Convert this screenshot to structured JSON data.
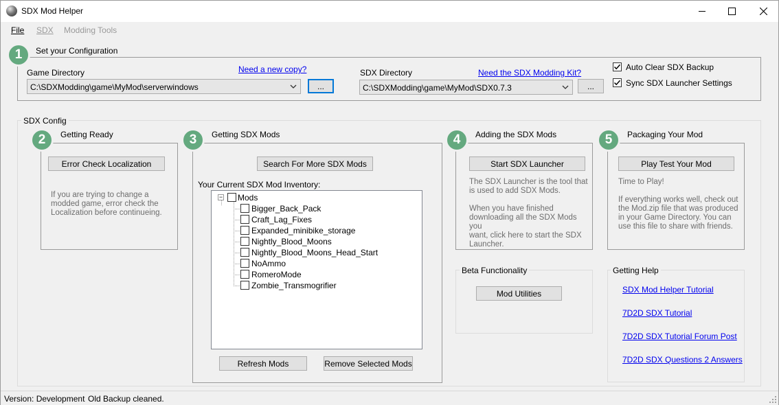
{
  "window": {
    "title": "SDX Mod Helper",
    "accent": "#64a97f",
    "link_color": "#0000ee"
  },
  "menu": {
    "file": "File",
    "sdx": "SDX",
    "modding_tools": "Modding Tools"
  },
  "config": {
    "step": "1",
    "title": "Set your Configuration",
    "game_dir_label": "Game Directory",
    "game_dir_link": "Need a new copy?",
    "game_dir_value": "C:\\SDXModding\\game\\MyMod\\serverwindows",
    "browse_label": "...",
    "sdx_dir_label": "SDX Directory",
    "sdx_dir_link": "Need the SDX Modding Kit?",
    "sdx_dir_value": "C:\\SDXModding\\game\\MyMod\\SDX0.7.3",
    "auto_clear_label": "Auto Clear SDX Backup",
    "auto_clear_checked": true,
    "sync_label": "Sync SDX Launcher Settings",
    "sync_checked": true
  },
  "sdx_config": {
    "title": "SDX Config"
  },
  "getting_ready": {
    "step": "2",
    "title": "Getting Ready",
    "button": "Error Check Localization",
    "desc_lines": [
      "If you are trying to change a",
      "modded game, error check the",
      "Localization before continueing."
    ]
  },
  "getting_mods": {
    "step": "3",
    "title": "Getting SDX Mods",
    "search_button": "Search For More SDX Mods",
    "inventory_label": "Your Current SDX Mod Inventory:",
    "tree_root": "Mods",
    "tree_expander": "−",
    "mods": [
      "Bigger_Back_Pack",
      "Craft_Lag_Fixes",
      "Expanded_minibike_storage",
      "Nightly_Blood_Moons",
      "Nightly_Blood_Moons_Head_Start",
      "NoAmmo",
      "RomeroMode",
      "Zombie_Transmogrifier"
    ],
    "refresh_button": "Refresh Mods",
    "remove_button": "Remove Selected Mods"
  },
  "adding_mods": {
    "step": "4",
    "title": "Adding the SDX Mods",
    "button": "Start SDX Launcher",
    "desc_lines": [
      "The SDX Launcher is the tool that",
      "is used to add SDX Mods.",
      "",
      "When you have finished",
      "downloading all the SDX Mods you",
      "want, click here to start the SDX",
      "Launcher."
    ]
  },
  "packaging": {
    "step": "5",
    "title": "Packaging Your Mod",
    "button": "Play Test Your Mod",
    "desc_lines": [
      "Time to Play!",
      "",
      "If everything works well, check out",
      "the Mod.zip file that was produced",
      "in your Game Directory. You can",
      "use this file to share with friends."
    ]
  },
  "beta": {
    "title": "Beta Functionality",
    "button": "Mod Utilities"
  },
  "help": {
    "title": "Getting Help",
    "links": [
      "SDX Mod Helper Tutorial",
      "7D2D SDX Tutorial",
      "7D2D SDX Tutorial Forum Post",
      "7D2D SDX Questions 2 Answers"
    ]
  },
  "status": {
    "version": "Version: Development",
    "message": "Old Backup cleaned."
  },
  "icons": {
    "app": "sdx-app-icon",
    "minimize": "minimize-icon",
    "maximize": "maximize-icon",
    "close": "close-icon",
    "dropdown": "chevron-down-icon",
    "check": "checkmark-icon",
    "grip": "resize-grip-icon"
  }
}
